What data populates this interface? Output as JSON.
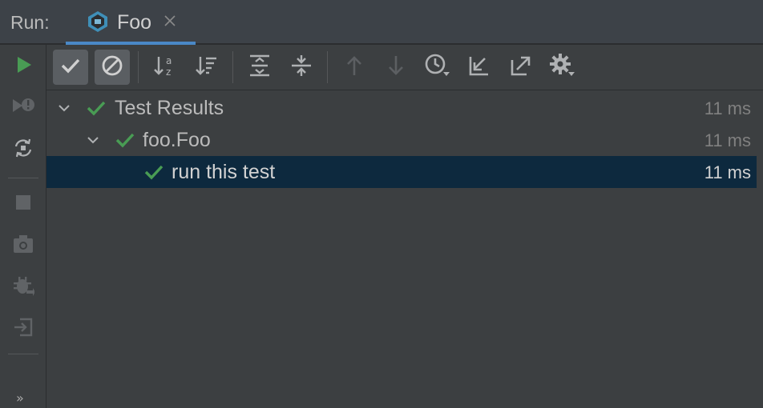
{
  "header": {
    "title": "Run:",
    "tab": {
      "label": "Foo",
      "icon": "cube-test-icon",
      "close_icon": "close-icon"
    }
  },
  "sidebar": {
    "items": [
      {
        "name": "rerun",
        "icon": "play-icon",
        "color": "#499c54"
      },
      {
        "name": "rerun-failed",
        "icon": "rerun-failed-icon"
      },
      {
        "name": "toggle-auto-test",
        "icon": "auto-rerun-icon"
      },
      {
        "name": "stop",
        "icon": "stop-icon"
      },
      {
        "name": "screenshot",
        "icon": "camera-icon"
      },
      {
        "name": "debug",
        "icon": "bug-icon"
      },
      {
        "name": "import-tests",
        "icon": "import-icon"
      }
    ],
    "more": "»"
  },
  "toolbar": {
    "buttons": [
      {
        "name": "show-passed",
        "icon": "check-icon",
        "active": true
      },
      {
        "name": "show-ignored",
        "icon": "ignored-icon",
        "active": true
      },
      {
        "name": "sort-alphabetically",
        "icon": "sort-alpha-icon"
      },
      {
        "name": "sort-by-duration",
        "icon": "sort-duration-icon"
      },
      {
        "name": "expand-all",
        "icon": "expand-all-icon"
      },
      {
        "name": "collapse-all",
        "icon": "collapse-all-icon"
      },
      {
        "name": "previous-failed",
        "icon": "arrow-up-icon"
      },
      {
        "name": "next-failed",
        "icon": "arrow-down-icon"
      },
      {
        "name": "test-history",
        "icon": "history-icon"
      },
      {
        "name": "import-test-results",
        "icon": "import-results-icon"
      },
      {
        "name": "export-test-results",
        "icon": "export-results-icon"
      },
      {
        "name": "settings",
        "icon": "gear-icon"
      }
    ]
  },
  "tree": {
    "rows": [
      {
        "label": "Test Results",
        "time": "11 ms",
        "status": "passed",
        "expanded": true
      },
      {
        "label": "foo.Foo",
        "time": "11 ms",
        "status": "passed",
        "expanded": true
      },
      {
        "label": "run this test",
        "time": "11 ms",
        "status": "passed",
        "selected": true
      }
    ]
  },
  "colors": {
    "background": "#3c3f41",
    "selection": "#0d293e",
    "pass_green": "#499c54",
    "tab_accent": "#4a88c7"
  }
}
